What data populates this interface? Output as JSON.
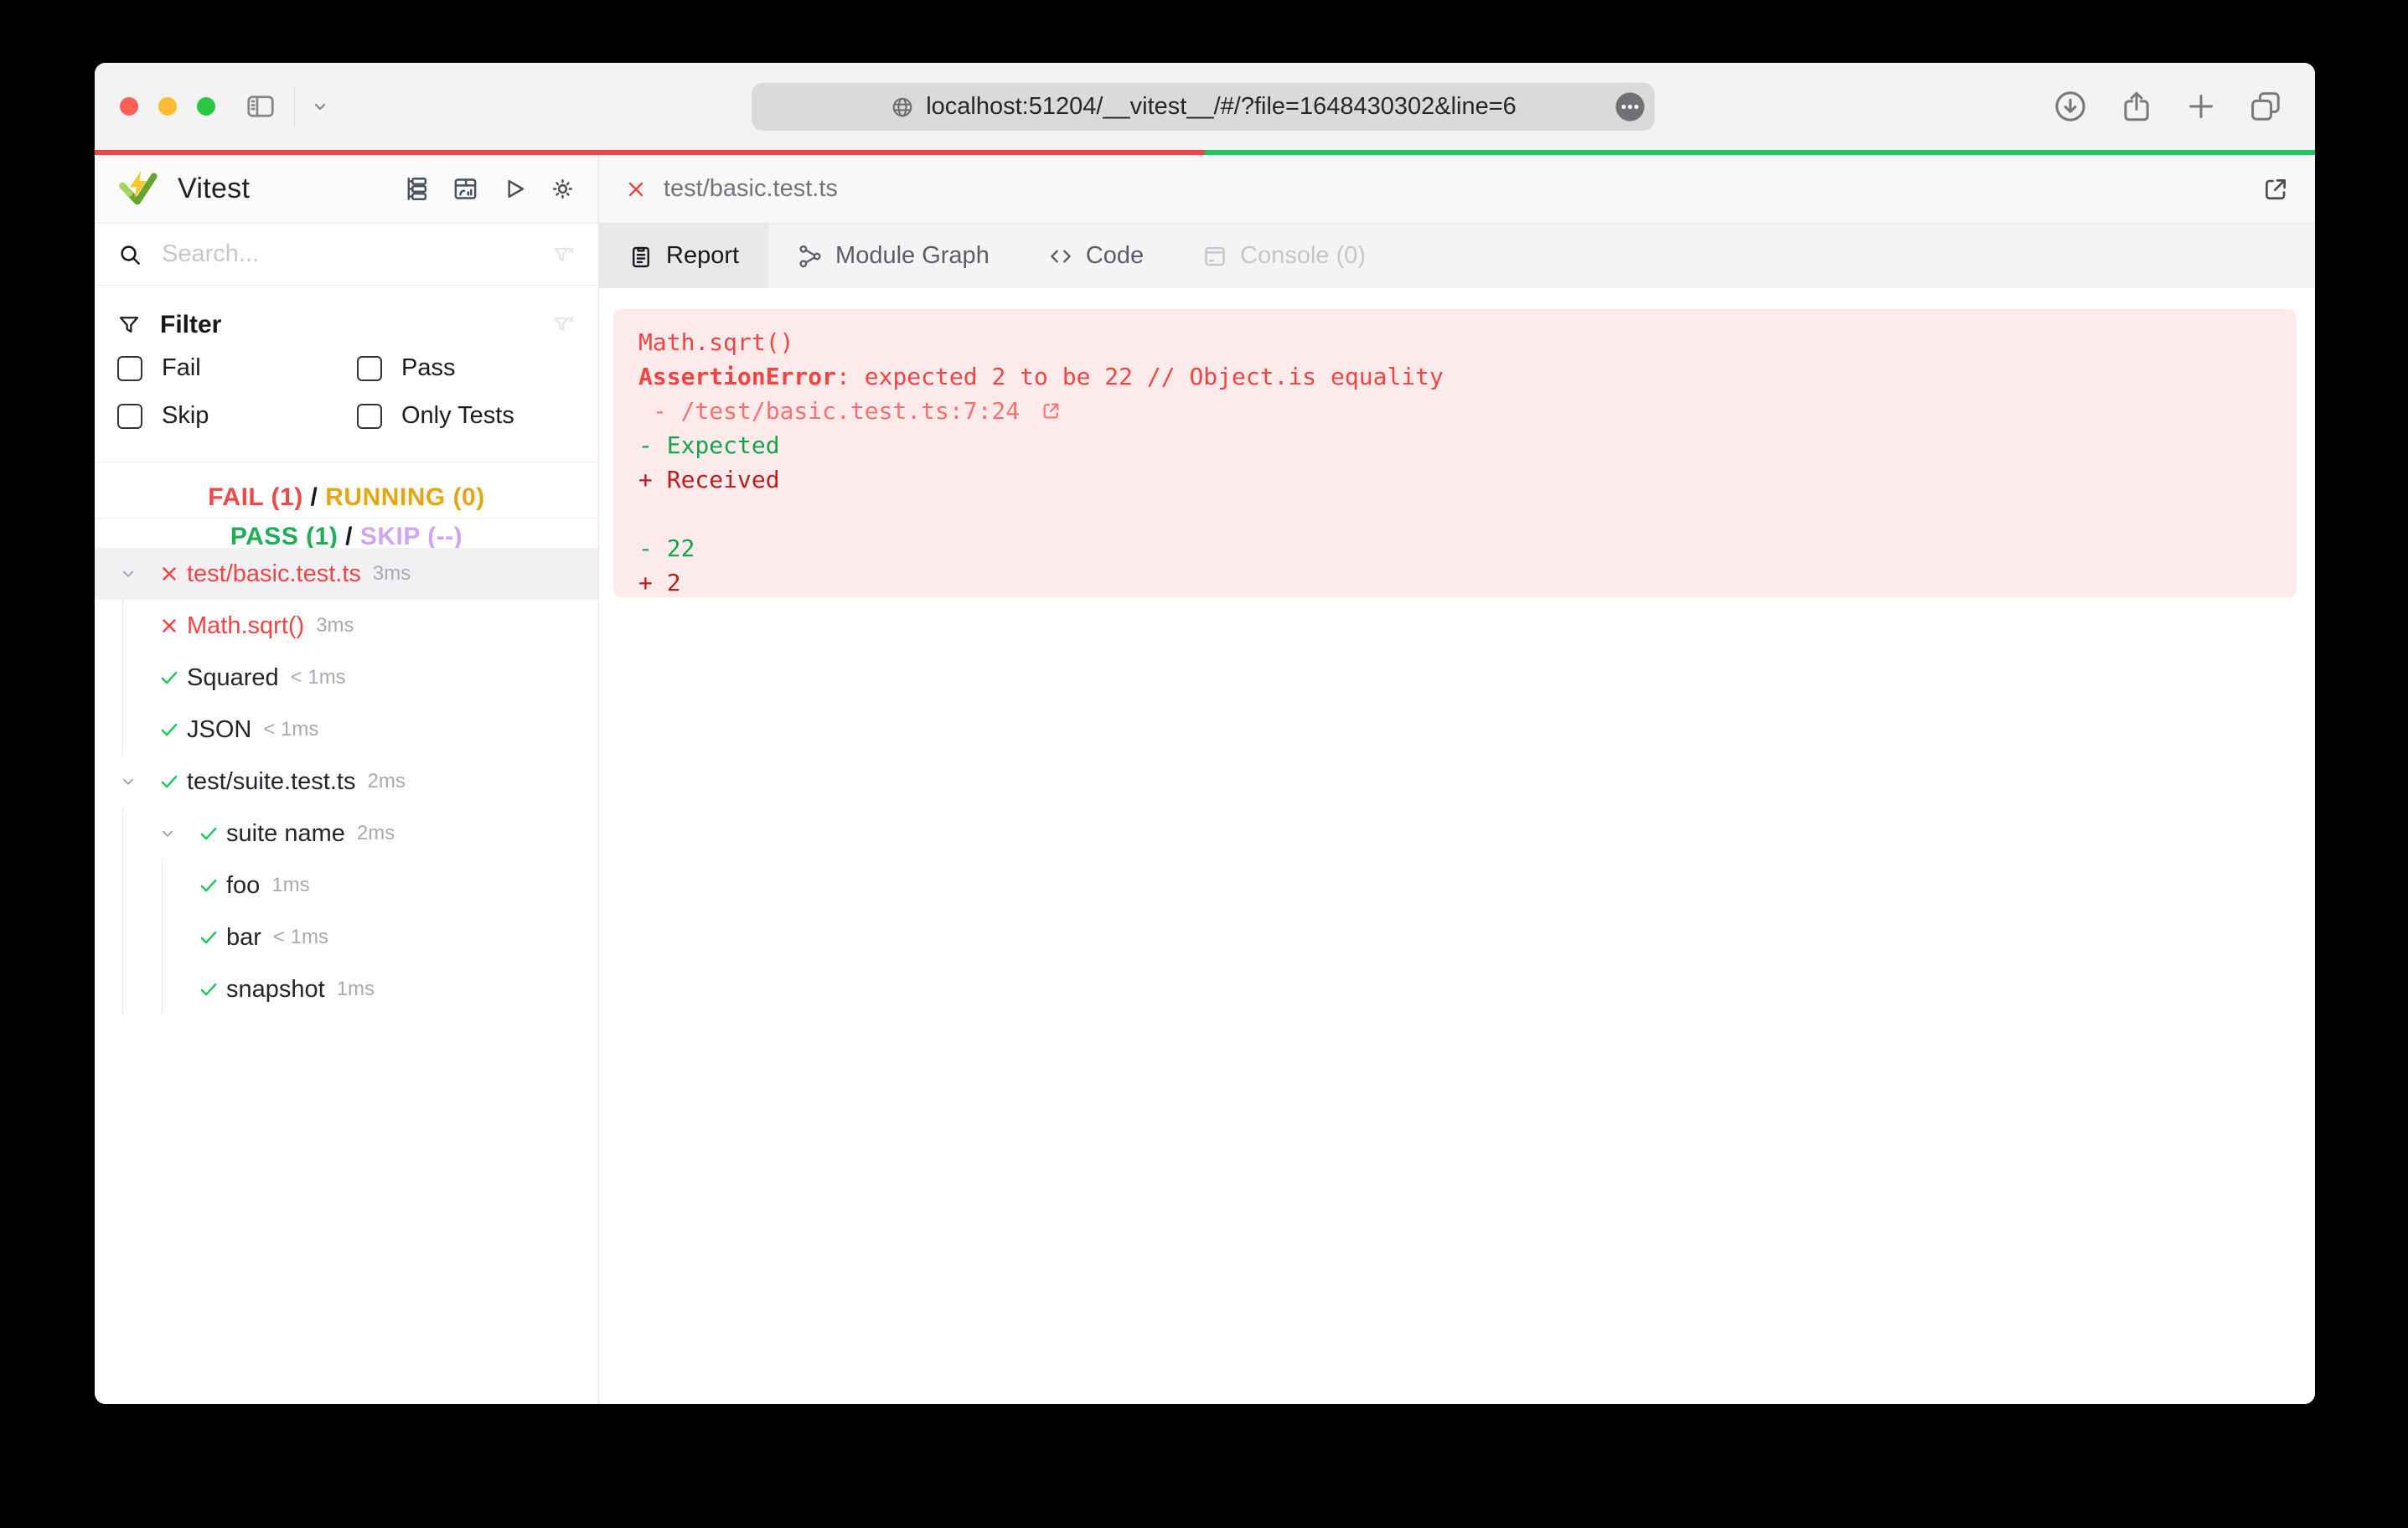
{
  "browser": {
    "url": "localhost:51204/__vitest__/#/?file=1648430302&line=6",
    "traffic_lights": [
      "close",
      "minimize",
      "zoom"
    ],
    "left_icons": [
      "sidebar-toggle-icon",
      "chevron-down-icon"
    ],
    "url_icons": [
      "globe-icon",
      "more-circle-icon"
    ],
    "right_icons": [
      "download-icon",
      "share-icon",
      "new-tab-icon",
      "tabs-overview-icon"
    ]
  },
  "progress": {
    "fail_fraction": 0.5,
    "fail_color": "#ef4444",
    "pass_color": "#22c55e"
  },
  "sidebar": {
    "app_title": "Vitest",
    "header_icons": [
      "tree-list-icon",
      "dashboard-icon",
      "run-all-icon",
      "theme-sun-icon"
    ],
    "search_placeholder": "Search...",
    "filter": {
      "title": "Filter",
      "options": [
        "Fail",
        "Pass",
        "Skip",
        "Only Tests"
      ],
      "checked": [
        false,
        false,
        false,
        false
      ]
    },
    "summary": {
      "fail": "FAIL (1)",
      "running": "RUNNING (0)",
      "pass": "PASS (1)",
      "skip": "SKIP (--)",
      "separator": "/"
    },
    "tree": [
      {
        "level": 0,
        "chevron": true,
        "status": "fail",
        "label": "test/basic.test.ts",
        "duration": "3ms",
        "selected": true
      },
      {
        "level": 1,
        "chevron": false,
        "status": "fail",
        "label": "Math.sqrt()",
        "duration": "3ms",
        "selected": false
      },
      {
        "level": 1,
        "chevron": false,
        "status": "pass",
        "label": "Squared",
        "duration": "< 1ms",
        "selected": false
      },
      {
        "level": 1,
        "chevron": false,
        "status": "pass",
        "label": "JSON",
        "duration": "< 1ms",
        "selected": false
      },
      {
        "level": 0,
        "chevron": true,
        "status": "pass",
        "label": "test/suite.test.ts",
        "duration": "2ms",
        "selected": false
      },
      {
        "level": 1,
        "chevron": true,
        "status": "pass",
        "label": "suite name",
        "duration": "2ms",
        "selected": false
      },
      {
        "level": 2,
        "chevron": false,
        "status": "pass",
        "label": "foo",
        "duration": "1ms",
        "selected": false
      },
      {
        "level": 2,
        "chevron": false,
        "status": "pass",
        "label": "bar",
        "duration": "< 1ms",
        "selected": false
      },
      {
        "level": 2,
        "chevron": false,
        "status": "pass",
        "label": "snapshot",
        "duration": "1ms",
        "selected": false
      }
    ]
  },
  "main": {
    "file_tab": {
      "label": "test/basic.test.ts",
      "close_icon": "close-icon",
      "external_icon": "external-link-icon"
    },
    "tabs": [
      {
        "label": "Report",
        "icon": "clipboard-icon",
        "active": true,
        "disabled": false
      },
      {
        "label": "Module Graph",
        "icon": "module-graph-icon",
        "active": false,
        "disabled": false
      },
      {
        "label": "Code",
        "icon": "code-icon",
        "active": false,
        "disabled": false
      },
      {
        "label": "Console (0)",
        "icon": "console-icon",
        "active": false,
        "disabled": true
      }
    ],
    "error_panel": {
      "background": "#fdebeb",
      "lines": [
        {
          "spans": [
            {
              "t": "Math.sqrt()",
              "c": "#ef4444"
            }
          ]
        },
        {
          "spans": [
            {
              "t": "AssertionError",
              "c": "#ef4444",
              "b": true
            },
            {
              "t": ": expected 2 to be 22 // Object.is equality",
              "c": "#ef4444"
            }
          ]
        },
        {
          "spans": [
            {
              "t": " - /test/basic.test.ts:7:24 ",
              "c": "#f87171"
            },
            {
              "icon": "external-link-icon"
            }
          ]
        },
        {
          "spans": [
            {
              "t": "- Expected",
              "c": "#16a34a"
            }
          ]
        },
        {
          "spans": [
            {
              "t": "+ Received",
              "c": "#b91c1c"
            }
          ]
        },
        {
          "spans": []
        },
        {
          "spans": [
            {
              "t": "- 22",
              "c": "#16a34a"
            }
          ]
        },
        {
          "spans": [
            {
              "t": "+ 2",
              "c": "#b91c1c"
            }
          ]
        }
      ]
    }
  },
  "status_colors": {
    "fail": "#ef4444",
    "pass": "#22c55e",
    "running": "#e3a715",
    "skip": "#cfa5f6",
    "diff_expected": "#16a34a",
    "diff_received": "#b91c1c"
  }
}
